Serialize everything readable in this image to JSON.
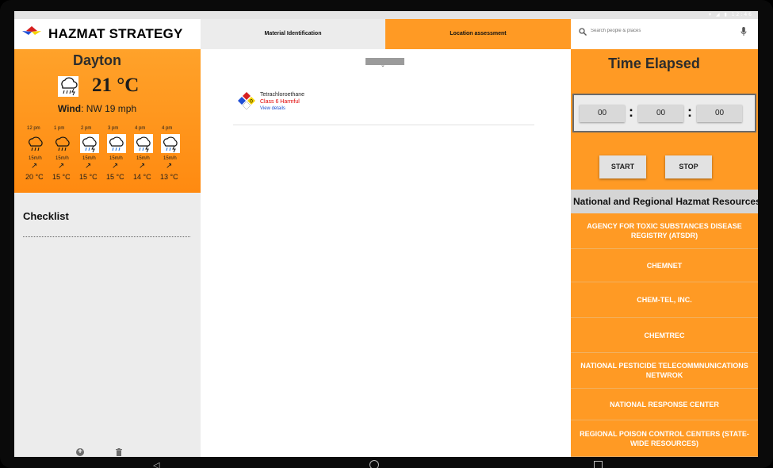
{
  "status_bar": {
    "time": "12:46"
  },
  "brand": {
    "title": "HAZMAT STRATEGY",
    "logo_colors": [
      "#d61f1f",
      "#1f4fd6",
      "#f5d400"
    ]
  },
  "weather": {
    "city": "Dayton",
    "temperature": "21 °C",
    "wind_label": "Wind",
    "wind_value": ": NW 19 mph",
    "current_icon": "cloud-rain-icon",
    "hourly": [
      {
        "time": "12 pm",
        "speed": "15m/h",
        "temp": "20 °C",
        "icon": "cloud-rain-icon"
      },
      {
        "time": "1 pm",
        "speed": "15m/h",
        "temp": "15 °C",
        "icon": "cloud-rain-icon"
      },
      {
        "time": "2 pm",
        "speed": "15m/h",
        "temp": "15 °C",
        "icon": "cloud-rain-icon"
      },
      {
        "time": "3 pm",
        "speed": "15m/h",
        "temp": "15 °C",
        "icon": "cloud-rain-icon"
      },
      {
        "time": "4 pm",
        "speed": "15m/h",
        "temp": "14 °C",
        "icon": "cloud-rain-icon"
      },
      {
        "time": "4 pm",
        "speed": "15m/h",
        "temp": "13 °C",
        "icon": "cloud-rain-icon"
      }
    ]
  },
  "checklist": {
    "title": "Checklist"
  },
  "tabs": [
    {
      "label": "Material Identification"
    },
    {
      "label": "Location assessment"
    }
  ],
  "material": {
    "name": "Tetrachloroethane",
    "class": "Class 6 Harmful",
    "link": "View details",
    "nfpa_health": "",
    "nfpa_reactivity": "0"
  },
  "search": {
    "placeholder": "Search people & places"
  },
  "timer": {
    "title": "Time Elapsed",
    "hours": "00",
    "minutes": "00",
    "seconds": "00",
    "start_label": "START",
    "stop_label": "STOP"
  },
  "resources": {
    "title": "National and Regional Hazmat Resources",
    "items": [
      "AGENCY FOR TOXIC SUBSTANCES DISEASE REGISTRY (ATSDR)",
      "CHEMNET",
      "CHEM-TEL, INC.",
      "CHEMTREC",
      "NATIONAL PESTICIDE TELECOMMNUNICATIONS NETWROK",
      "NATIONAL RESPONSE CENTER",
      "REGIONAL POISON CONTROL CENTERS (STATE-WIDE RESOURCES)"
    ]
  },
  "colors": {
    "accent": "#ff9a24",
    "panel_gray": "#ececec",
    "hazard_red": "#e00000",
    "link_blue": "#1a4fd1"
  }
}
